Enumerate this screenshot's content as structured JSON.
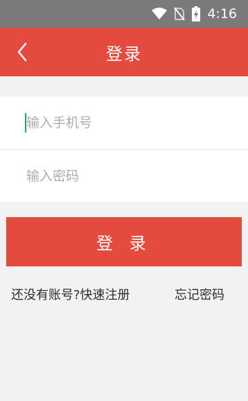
{
  "status_bar": {
    "time": "4:16",
    "icons": [
      "wifi-icon",
      "no-sim-icon",
      "battery-charging-icon"
    ]
  },
  "header": {
    "title": "登录",
    "back_icon": "chevron-left-icon"
  },
  "form": {
    "phone_placeholder": "输入手机号",
    "password_placeholder": "输入密码"
  },
  "login_button": "登 录",
  "links": {
    "register": "还没有账号?快速注册",
    "forgot_password": "忘记密码"
  },
  "colors": {
    "accent": "#e34b3e",
    "status_bar": "#7a7a7a",
    "background": "#f2f2f2",
    "caret": "#19a08f"
  }
}
